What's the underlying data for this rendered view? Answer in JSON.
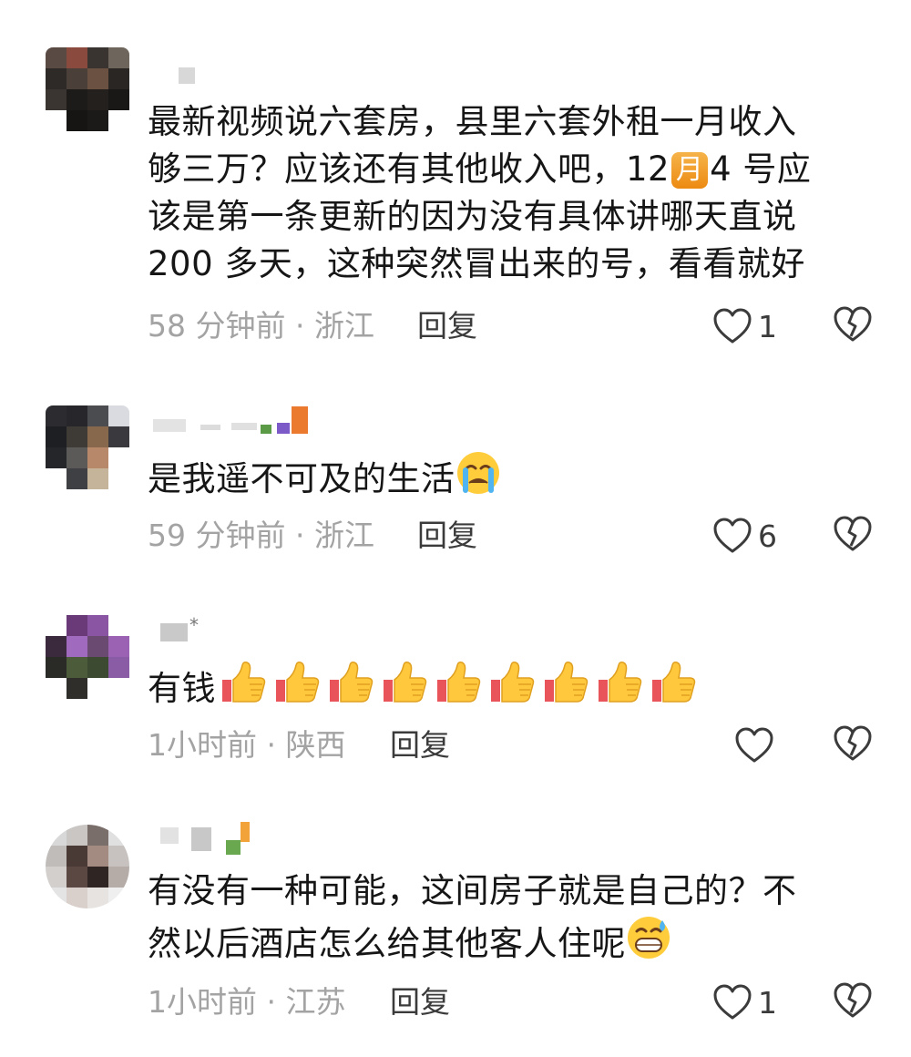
{
  "comments": [
    {
      "text_lines": [
        "最新视频说六套房，县里六套外租一月收入",
        "够三万？应该还有其他收入吧，12",
        "该是第一条更新的因为没有具体讲哪天直说",
        "200 多天，这种突然冒出来的号，看看就好"
      ],
      "month_badge": "月",
      "text_after_badge": "4 号应",
      "time_location": "58 分钟前 · 浙江",
      "reply_label": "回复",
      "like_count": "1"
    },
    {
      "text": "是我遥不可及的生活",
      "emoji": "crying-face",
      "time_location": "59 分钟前 · 浙江",
      "reply_label": "回复",
      "like_count": "6"
    },
    {
      "username_fragment": "*",
      "text": "有钱",
      "thumbs_up_count": 9,
      "time_location": "1小时前 · 陕西",
      "reply_label": "回复",
      "like_count": ""
    },
    {
      "text_lines": [
        "有没有一种可能，这间房子就是自己的？不",
        "然以后酒店怎么给其他客人住呢"
      ],
      "emoji": "grinning-sweat-face",
      "time_location": "1小时前 · 江苏",
      "reply_label": "回复",
      "like_count": "1"
    }
  ],
  "colors": {
    "text": "#161616",
    "meta": "#a3a3a3",
    "reply": "#3b3b3b",
    "badge": "#f0a030"
  }
}
